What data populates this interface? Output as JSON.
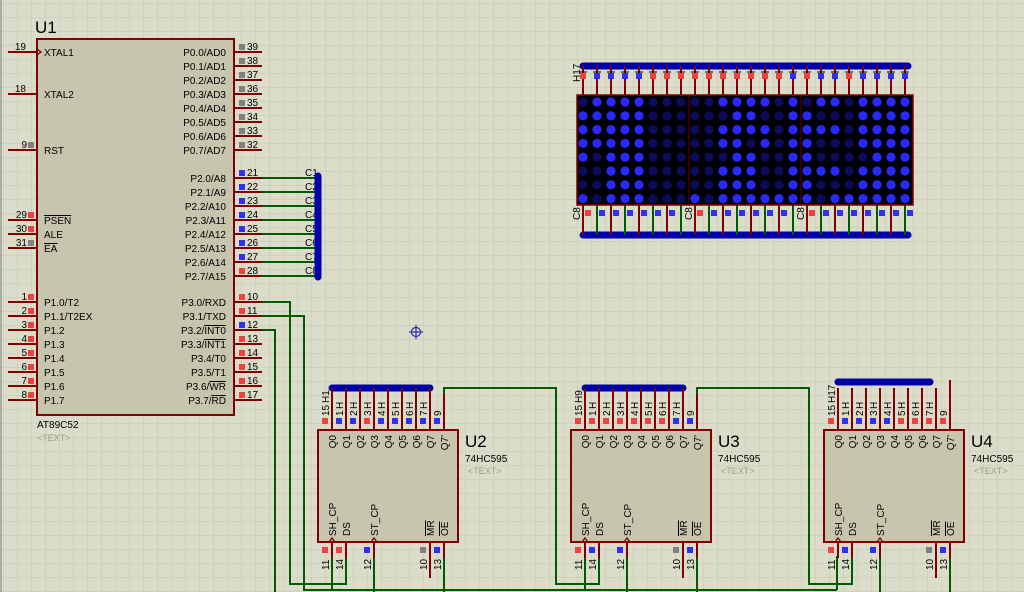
{
  "colors": {
    "background": "#dcdcca",
    "grid": "#c6c6b2",
    "body": "#c6c5ae",
    "body_border": "#800000",
    "wire": "#005a00",
    "bus": "#0000a8",
    "pin_red": "#f04040",
    "pin_blue": "#3030f0",
    "pin_gray": "#808080",
    "led_on": "#2828ff",
    "led_off": "#0c0c5a"
  },
  "u1": {
    "ref": "U1",
    "part": "AT89C52",
    "text": "<TEXT>",
    "left_pins": [
      {
        "num": "19",
        "name": "XTAL1",
        "state": "none"
      },
      {
        "num": "18",
        "name": "XTAL2",
        "state": "none"
      },
      {
        "num": "9",
        "name": "RST",
        "state": "gray"
      },
      {
        "num": "29",
        "name": "",
        "ov": "PSEN",
        "state": "red"
      },
      {
        "num": "30",
        "name": "ALE",
        "state": "red"
      },
      {
        "num": "31",
        "name": "",
        "ov": "EA",
        "state": "gray"
      },
      {
        "num": "1",
        "name": "P1.0/T2",
        "state": "red"
      },
      {
        "num": "2",
        "name": "P1.1/T2EX",
        "state": "red"
      },
      {
        "num": "3",
        "name": "P1.2",
        "state": "red"
      },
      {
        "num": "4",
        "name": "P1.3",
        "state": "red"
      },
      {
        "num": "5",
        "name": "P1.4",
        "state": "red"
      },
      {
        "num": "6",
        "name": "P1.5",
        "state": "red"
      },
      {
        "num": "7",
        "name": "P1.6",
        "state": "red"
      },
      {
        "num": "8",
        "name": "P1.7",
        "state": "red"
      }
    ],
    "right_pins": [
      {
        "num": "39",
        "name": "P0.0/AD0",
        "state": "gray"
      },
      {
        "num": "38",
        "name": "P0.1/AD1",
        "state": "gray"
      },
      {
        "num": "37",
        "name": "P0.2/AD2",
        "state": "gray"
      },
      {
        "num": "36",
        "name": "P0.3/AD3",
        "state": "gray"
      },
      {
        "num": "35",
        "name": "P0.4/AD4",
        "state": "gray"
      },
      {
        "num": "34",
        "name": "P0.5/AD5",
        "state": "gray"
      },
      {
        "num": "33",
        "name": "P0.6/AD6",
        "state": "gray"
      },
      {
        "num": "32",
        "name": "P0.7/AD7",
        "state": "gray"
      },
      {
        "num": "21",
        "name": "P2.0/A8",
        "state": "blue"
      },
      {
        "num": "22",
        "name": "P2.1/A9",
        "state": "blue"
      },
      {
        "num": "23",
        "name": "P2.2/A10",
        "state": "blue"
      },
      {
        "num": "24",
        "name": "P2.3/A11",
        "state": "blue"
      },
      {
        "num": "25",
        "name": "P2.4/A12",
        "state": "blue"
      },
      {
        "num": "26",
        "name": "P2.5/A13",
        "state": "blue"
      },
      {
        "num": "27",
        "name": "P2.6/A14",
        "state": "blue"
      },
      {
        "num": "28",
        "name": "P2.7/A15",
        "state": "red"
      },
      {
        "num": "10",
        "name": "P3.0/RXD",
        "state": "red"
      },
      {
        "num": "11",
        "name": "P3.1/TXD",
        "state": "red"
      },
      {
        "num": "12",
        "name": "P3.2/",
        "ov": "INT0",
        "state": "blue"
      },
      {
        "num": "13",
        "name": "P3.3/",
        "ov": "INT1",
        "state": "red"
      },
      {
        "num": "14",
        "name": "P3.4/T0",
        "state": "red"
      },
      {
        "num": "15",
        "name": "P3.5/T1",
        "state": "red"
      },
      {
        "num": "16",
        "name": "P3.6/",
        "ov": "WR",
        "state": "red"
      },
      {
        "num": "17",
        "name": "P3.7/",
        "ov": "RD",
        "state": "red"
      }
    ]
  },
  "bus_labels": [
    "C1",
    "C2",
    "C3",
    "C4",
    "C5",
    "C6",
    "C7",
    "C8"
  ],
  "q_labels": [
    "Q0",
    "Q1",
    "Q2",
    "Q3",
    "Q4",
    "Q5",
    "Q6",
    "Q7",
    "Q7'"
  ],
  "shift_registers": [
    {
      "ref": "U2",
      "part": "74HC595",
      "text": "<TEXT>",
      "outputs": [
        {
          "num": "15",
          "net": "H1",
          "state": "red"
        },
        {
          "num": "1",
          "net": "H",
          "state": "blue"
        },
        {
          "num": "2",
          "net": "H",
          "state": "blue"
        },
        {
          "num": "3",
          "net": "H",
          "state": "red"
        },
        {
          "num": "4",
          "net": "H",
          "state": "blue"
        },
        {
          "num": "5",
          "net": "H",
          "state": "blue"
        },
        {
          "num": "6",
          "net": "H",
          "state": "blue"
        },
        {
          "num": "7",
          "net": "H",
          "state": "blue"
        },
        {
          "num": "9",
          "net": "",
          "state": "blue"
        }
      ],
      "inputs": [
        {
          "num": "11",
          "name": "SH_CP",
          "state": "red"
        },
        {
          "num": "14",
          "name": "DS",
          "state": "red"
        },
        {
          "num": "12",
          "name": "ST_CP",
          "state": "blue"
        },
        {
          "num": "10",
          "name": "MR",
          "overline": true,
          "state": "gray"
        },
        {
          "num": "13",
          "name": "OE",
          "overline": true,
          "state": "blue"
        }
      ]
    },
    {
      "ref": "U3",
      "part": "74HC595",
      "text": "<TEXT>",
      "outputs": [
        {
          "num": "15",
          "net": "H9",
          "state": "red"
        },
        {
          "num": "1",
          "net": "H",
          "state": "red"
        },
        {
          "num": "2",
          "net": "H",
          "state": "red"
        },
        {
          "num": "3",
          "net": "H",
          "state": "red"
        },
        {
          "num": "4",
          "net": "H",
          "state": "red"
        },
        {
          "num": "5",
          "net": "H",
          "state": "red"
        },
        {
          "num": "6",
          "net": "H",
          "state": "red"
        },
        {
          "num": "7",
          "net": "H",
          "state": "blue"
        },
        {
          "num": "9",
          "net": "",
          "state": "blue"
        }
      ],
      "inputs": [
        {
          "num": "11",
          "name": "SH_CP",
          "state": "red"
        },
        {
          "num": "14",
          "name": "DS",
          "state": "blue"
        },
        {
          "num": "12",
          "name": "ST_CP",
          "state": "blue"
        },
        {
          "num": "10",
          "name": "MR",
          "overline": true,
          "state": "gray"
        },
        {
          "num": "13",
          "name": "OE",
          "overline": true,
          "state": "blue"
        }
      ]
    },
    {
      "ref": "U4",
      "part": "74HC595",
      "text": "<TEXT>",
      "outputs": [
        {
          "num": "15",
          "net": "H17",
          "state": "red"
        },
        {
          "num": "1",
          "net": "H",
          "state": "blue"
        },
        {
          "num": "2",
          "net": "H",
          "state": "blue"
        },
        {
          "num": "3",
          "net": "H",
          "state": "blue"
        },
        {
          "num": "4",
          "net": "H",
          "state": "blue"
        },
        {
          "num": "5",
          "net": "H",
          "state": "red"
        },
        {
          "num": "6",
          "net": "H",
          "state": "red"
        },
        {
          "num": "7",
          "net": "H",
          "state": "red"
        },
        {
          "num": "9",
          "net": "",
          "state": "red"
        }
      ],
      "inputs": [
        {
          "num": "11",
          "name": "SH_CP",
          "state": "red"
        },
        {
          "num": "14",
          "name": "DS",
          "state": "blue"
        },
        {
          "num": "12",
          "name": "ST_CP",
          "state": "blue"
        },
        {
          "num": "10",
          "name": "MR",
          "overline": true,
          "state": "gray"
        },
        {
          "num": "13",
          "name": "OE",
          "overline": true,
          "state": "blue"
        }
      ]
    }
  ],
  "matrix": {
    "top_label": "H17",
    "bottom_labels": [
      "C8",
      "C8",
      "C8"
    ],
    "top_states": [
      "red",
      "blue",
      "blue",
      "blue",
      "blue",
      "red",
      "red",
      "red",
      "red",
      "red",
      "red",
      "red",
      "red",
      "red",
      "red",
      "blue",
      "red",
      "blue",
      "blue",
      "red",
      "blue",
      "blue",
      "blue",
      "blue"
    ],
    "bottom_states": [
      "red",
      "blue",
      "blue",
      "blue",
      "blue",
      "blue",
      "blue",
      "none",
      "red",
      "blue",
      "blue",
      "blue",
      "blue",
      "blue",
      "blue",
      "none",
      "red",
      "blue",
      "blue",
      "blue",
      "blue",
      "blue",
      "blue",
      "blue"
    ],
    "rows": [
      "011110000011110101101111",
      "111110000001100110001111",
      "111110000011110111101111",
      "111110000011010110001111",
      "101110000001100110000111",
      "001110000011100111101111",
      "001110000011100110001111",
      "101110001011111110111111"
    ]
  }
}
